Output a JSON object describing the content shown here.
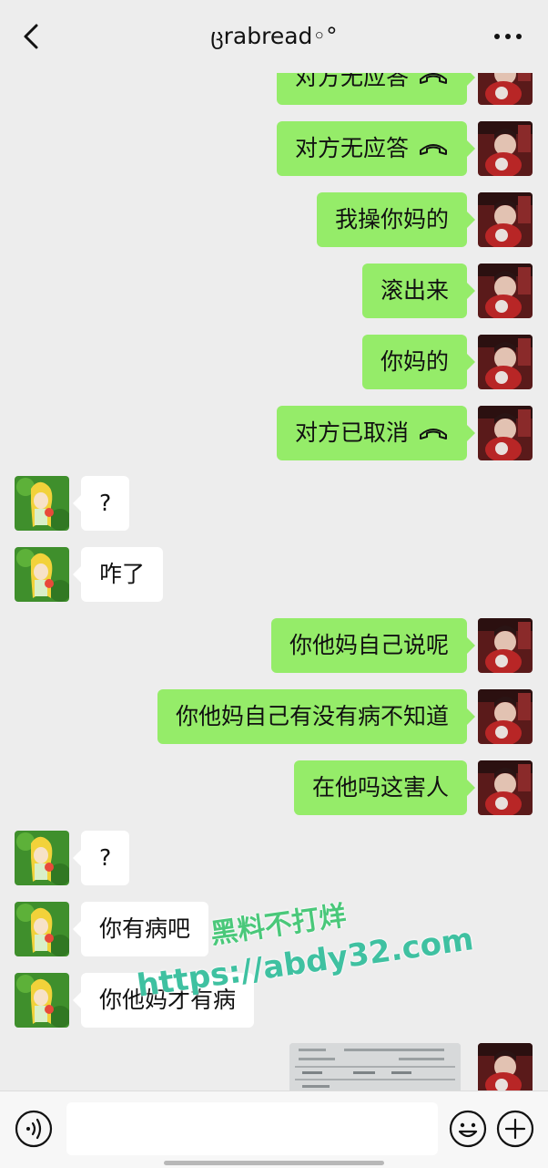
{
  "header": {
    "title": "ცrabread◦°",
    "back_icon": "chevron-left-icon",
    "more_icon": "more-dots-icon"
  },
  "messages": [
    {
      "dir": "out",
      "text": "对方无应答",
      "call_icon": true
    },
    {
      "dir": "out",
      "text": "对方无应答",
      "call_icon": true
    },
    {
      "dir": "out",
      "text": "我操你妈的"
    },
    {
      "dir": "out",
      "text": "滚出来"
    },
    {
      "dir": "out",
      "text": "你妈的"
    },
    {
      "dir": "out",
      "text": "对方已取消",
      "call_icon": true
    },
    {
      "dir": "in",
      "text": "?"
    },
    {
      "dir": "in",
      "text": "咋了"
    },
    {
      "dir": "out",
      "text": "你他妈自己说呢"
    },
    {
      "dir": "out",
      "text": "你他妈自己有没有病不知道"
    },
    {
      "dir": "out",
      "text": "在他吗这害人"
    },
    {
      "dir": "in",
      "text": "?"
    },
    {
      "dir": "in",
      "text": "你有病吧"
    },
    {
      "dir": "in",
      "text": "你他妈才有病"
    }
  ],
  "watermark": {
    "line1": "黑料不打烊",
    "line2": "https://abdy32.com"
  },
  "input_bar": {
    "voice_icon": "voice-icon",
    "emoji_icon": "emoji-icon",
    "plus_icon": "plus-circle-icon",
    "text_value": ""
  },
  "colors": {
    "background": "#ededed",
    "outgoing_bubble": "#95ec69",
    "incoming_bubble": "#ffffff",
    "watermark_green": "#4ac87a"
  }
}
